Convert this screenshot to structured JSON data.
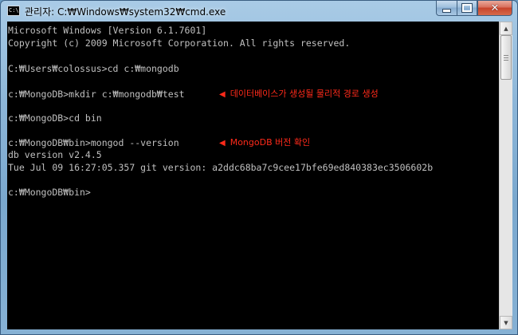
{
  "window": {
    "title": "관리자: C:₩Windows₩system32₩cmd.exe",
    "icon": "cmd-icon",
    "buttons": {
      "minimize": "minimize-icon",
      "maximize": "maximize-icon",
      "close": "close-icon"
    }
  },
  "console": {
    "lines": [
      "Microsoft Windows [Version 6.1.7601]",
      "Copyright (c) 2009 Microsoft Corporation. All rights reserved.",
      "",
      "C:₩Users₩colossus>cd c:₩mongodb",
      "",
      "c:₩MongoDB>mkdir c:₩mongodb₩test",
      "",
      "c:₩MongoDB>cd bin",
      "",
      "c:₩MongoDB₩bin>mongod --version",
      "db version v2.4.5",
      "Tue Jul 09 16:27:05.357 git version: a2ddc68ba7c9cee17bfe69ed840383ec3506602b",
      "",
      "c:₩MongoDB₩bin>"
    ],
    "text_color": "#c0c0c0",
    "background": "#000000"
  },
  "annotations": [
    {
      "arrow": "◀",
      "text": "데이터베이스가 생성될 물리적 경로 생성",
      "line": 5
    },
    {
      "arrow": "◀",
      "text": "MongoDB 버전 확인",
      "line": 9
    }
  ],
  "annotation_color": "#ff2a1a"
}
